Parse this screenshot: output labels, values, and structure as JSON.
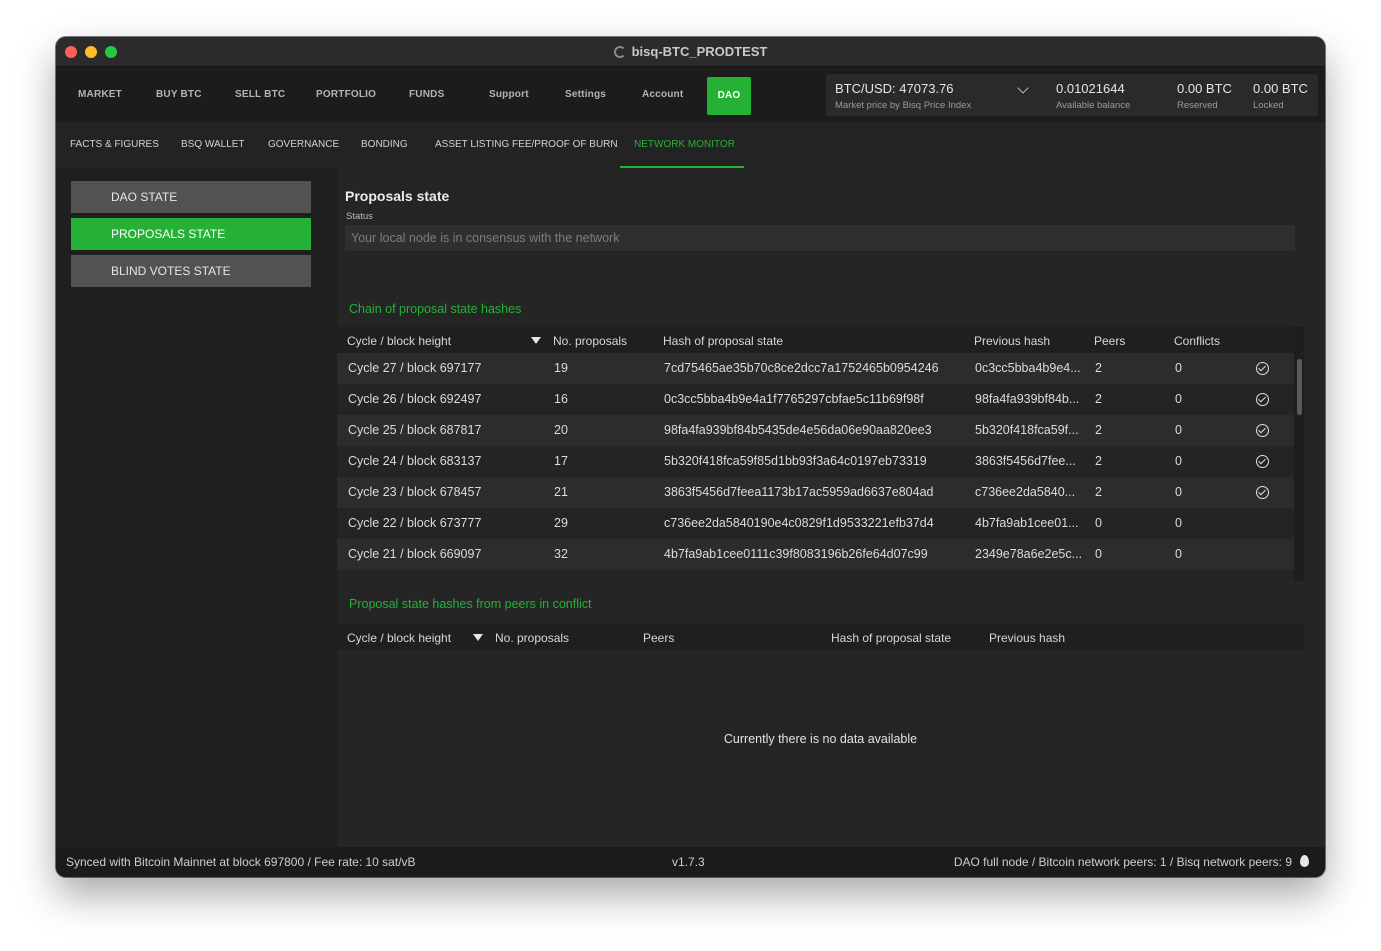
{
  "window": {
    "title": "bisq-BTC_PRODTEST"
  },
  "topnav": {
    "items": [
      "MARKET",
      "BUY BTC",
      "SELL BTC",
      "PORTFOLIO",
      "FUNDS",
      "Support",
      "Settings",
      "Account",
      "DAO"
    ],
    "active": "DAO"
  },
  "price": {
    "value": "BTC/USD: 47073.76",
    "label": "Market price by Bisq Price Index"
  },
  "balances": [
    {
      "value": "0.01021644",
      "label": "Available balance"
    },
    {
      "value": "0.00 BTC",
      "label": "Reserved"
    },
    {
      "value": "0.00 BTC",
      "label": "Locked"
    }
  ],
  "subnav": {
    "items": [
      "FACTS & FIGURES",
      "BSQ WALLET",
      "GOVERNANCE",
      "BONDING",
      "ASSET LISTING FEE/PROOF OF BURN",
      "NETWORK MONITOR"
    ],
    "active": "NETWORK MONITOR"
  },
  "sidebar": {
    "items": [
      "DAO STATE",
      "PROPOSALS STATE",
      "BLIND VOTES STATE"
    ],
    "active": "PROPOSALS STATE"
  },
  "main": {
    "title": "Proposals state",
    "status_label": "Status",
    "status_value": "Your local node is in consensus with the network",
    "chain_title": "Chain of proposal state hashes",
    "conflict_title": "Proposal state hashes from peers in conflict",
    "empty_message": "Currently there is no data available"
  },
  "chain_table": {
    "columns": [
      "Cycle / block height",
      "No. proposals",
      "Hash of proposal state",
      "Previous hash",
      "Peers",
      "Conflicts"
    ],
    "rows": [
      {
        "cycle": "Cycle 27 / block 697177",
        "proposals": "19",
        "hash": "7cd75465ae35b70c8ce2dcc7a1752465b0954246",
        "prev": "0c3cc5bba4b9e4...",
        "peers": "2",
        "conflicts": "0",
        "ok": true
      },
      {
        "cycle": "Cycle 26 / block 692497",
        "proposals": "16",
        "hash": "0c3cc5bba4b9e4a1f7765297cbfae5c11b69f98f",
        "prev": "98fa4fa939bf84b...",
        "peers": "2",
        "conflicts": "0",
        "ok": true
      },
      {
        "cycle": "Cycle 25 / block 687817",
        "proposals": "20",
        "hash": "98fa4fa939bf84b5435de4e56da06e90aa820ee3",
        "prev": "5b320f418fca59f...",
        "peers": "2",
        "conflicts": "0",
        "ok": true
      },
      {
        "cycle": "Cycle 24 / block 683137",
        "proposals": "17",
        "hash": "5b320f418fca59f85d1bb93f3a64c0197eb73319",
        "prev": "3863f5456d7fee...",
        "peers": "2",
        "conflicts": "0",
        "ok": true
      },
      {
        "cycle": "Cycle 23 / block 678457",
        "proposals": "21",
        "hash": "3863f5456d7feea1173b17ac5959ad6637e804ad",
        "prev": "c736ee2da5840...",
        "peers": "2",
        "conflicts": "0",
        "ok": true
      },
      {
        "cycle": "Cycle 22 / block 673777",
        "proposals": "29",
        "hash": "c736ee2da5840190e4c0829f1d9533221efb37d4",
        "prev": "4b7fa9ab1cee01...",
        "peers": "0",
        "conflicts": "0",
        "ok": false
      },
      {
        "cycle": "Cycle 21 / block 669097",
        "proposals": "32",
        "hash": "4b7fa9ab1cee0111c39f8083196b26fe64d07c99",
        "prev": "2349e78a6e2e5c...",
        "peers": "0",
        "conflicts": "0",
        "ok": false
      }
    ]
  },
  "conflict_table": {
    "columns": [
      "Cycle / block height",
      "No. proposals",
      "Peers",
      "Hash of proposal state",
      "Previous hash"
    ]
  },
  "statusbar": {
    "left": "Synced with Bitcoin Mainnet at block 697800 / Fee rate: 10 sat/vB",
    "center": "v1.7.3",
    "right": "DAO full node / Bitcoin network peers: 1 / Bisq network peers: 9"
  },
  "colors": {
    "accent": "#25b135",
    "background": "#1f1f1f"
  }
}
